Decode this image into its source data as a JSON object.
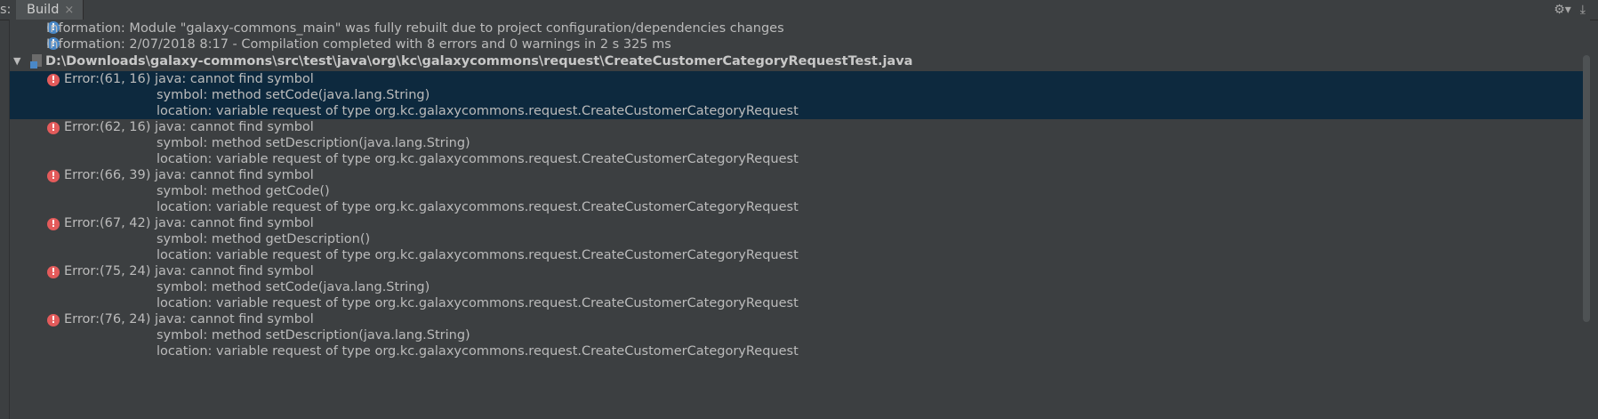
{
  "topbar": {
    "prefix": "s:",
    "tab_label": "Build",
    "close_glyph": "×",
    "icons": [
      "gear-icon",
      "download-icon"
    ]
  },
  "messages": {
    "info1": "Information: Module \"galaxy-commons_main\" was fully rebuilt due to project configuration/dependencies changes",
    "info2": "Information: 2/07/2018 8:17 - Compilation completed with 8 errors and 0 warnings in 2 s 325 ms",
    "file": "D:\\Downloads\\galaxy-commons\\src\\test\\java\\org\\kc\\galaxycommons\\request\\CreateCustomerCategoryRequestTest.java"
  },
  "errors": [
    {
      "head": "Error:(61, 16)  java: cannot find symbol",
      "symbol": "symbol:   method setCode(java.lang.String)",
      "location": "location: variable request of type org.kc.galaxycommons.request.CreateCustomerCategoryRequest"
    },
    {
      "head": "Error:(62, 16)  java: cannot find symbol",
      "symbol": "symbol:   method setDescription(java.lang.String)",
      "location": "location: variable request of type org.kc.galaxycommons.request.CreateCustomerCategoryRequest"
    },
    {
      "head": "Error:(66, 39)  java: cannot find symbol",
      "symbol": "symbol:   method getCode()",
      "location": "location: variable request of type org.kc.galaxycommons.request.CreateCustomerCategoryRequest"
    },
    {
      "head": "Error:(67, 42)  java: cannot find symbol",
      "symbol": "symbol:   method getDescription()",
      "location": "location: variable request of type org.kc.galaxycommons.request.CreateCustomerCategoryRequest"
    },
    {
      "head": "Error:(75, 24)  java: cannot find symbol",
      "symbol": "symbol:   method setCode(java.lang.String)",
      "location": "location: variable request of type org.kc.galaxycommons.request.CreateCustomerCategoryRequest"
    },
    {
      "head": "Error:(76, 24)  java: cannot find symbol",
      "symbol": "symbol:   method setDescription(java.lang.String)",
      "location": "location: variable request of type org.kc.galaxycommons.request.CreateCustomerCategoryRequest"
    }
  ],
  "colors": {
    "background": "#3c3f41",
    "selection": "#0d293e",
    "error_icon": "#e35b5b",
    "info_icon": "#4a88c7",
    "text": "#bbbbbb"
  }
}
